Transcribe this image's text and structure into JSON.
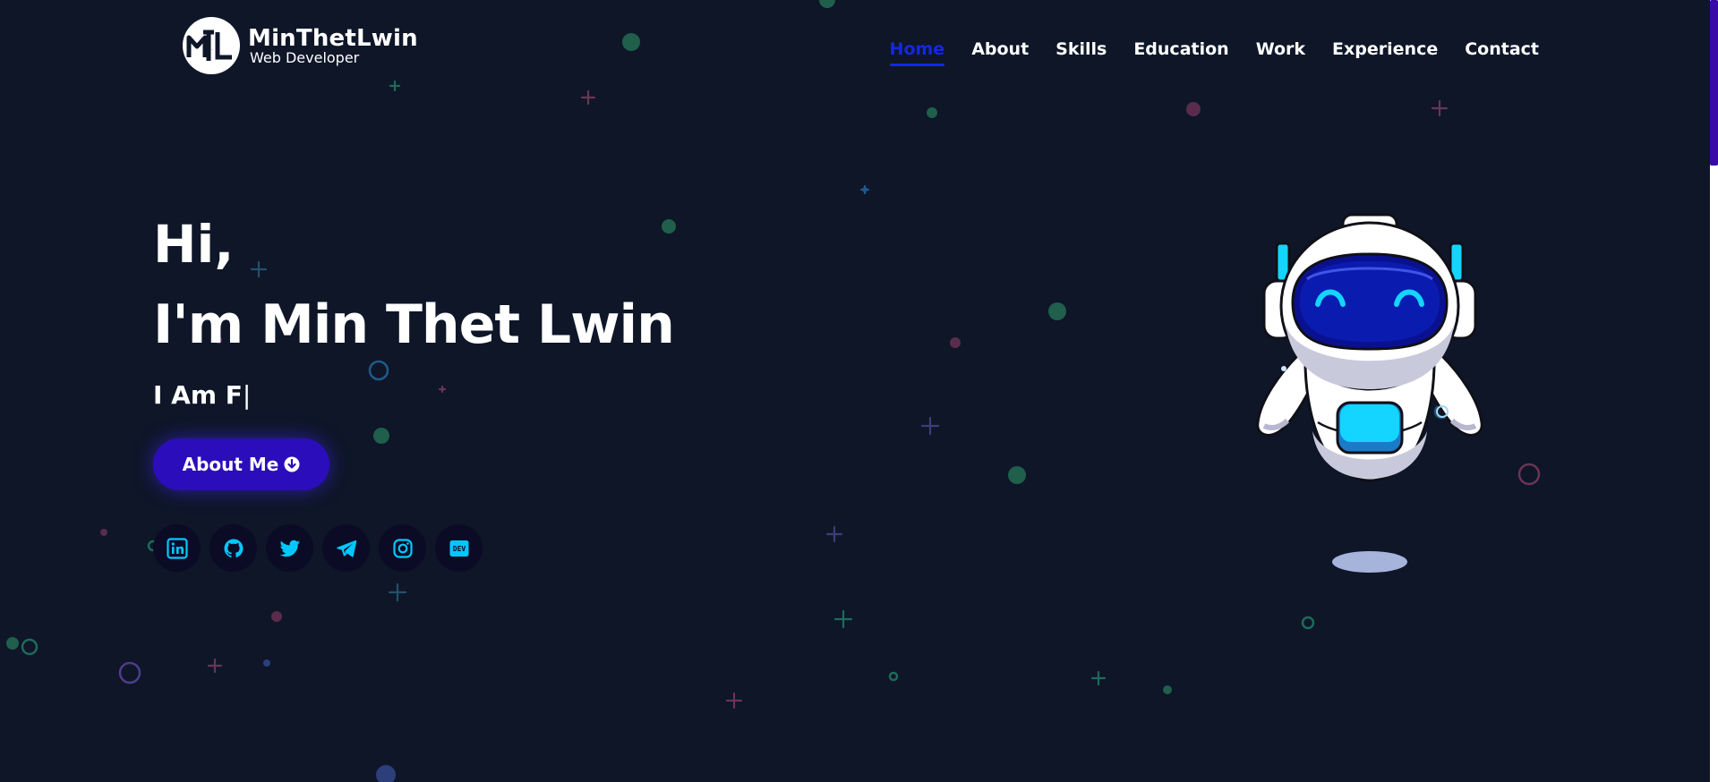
{
  "brand": {
    "monogram": "MTL",
    "name": "MinThetLwin",
    "subtitle": "Web Developer"
  },
  "nav": {
    "items": [
      {
        "label": "Home",
        "active": true
      },
      {
        "label": "About",
        "active": false
      },
      {
        "label": "Skills",
        "active": false
      },
      {
        "label": "Education",
        "active": false
      },
      {
        "label": "Work",
        "active": false
      },
      {
        "label": "Experience",
        "active": false
      },
      {
        "label": "Contact",
        "active": false
      }
    ]
  },
  "hero": {
    "greeting": "Hi,",
    "name": "I'm Min Thet Lwin",
    "typed_text": "I Am F",
    "caret": "|",
    "cta_label": "About Me",
    "cta_icon": "arrow-down-circle-icon"
  },
  "socials": [
    {
      "name": "linkedin",
      "icon": "linkedin-icon"
    },
    {
      "name": "github",
      "icon": "github-icon"
    },
    {
      "name": "twitter",
      "icon": "twitter-icon"
    },
    {
      "name": "telegram",
      "icon": "telegram-icon"
    },
    {
      "name": "instagram",
      "icon": "instagram-icon"
    },
    {
      "name": "dev",
      "icon": "dev-icon",
      "label": "DEV"
    }
  ],
  "colors": {
    "background": "#0e1628",
    "accent": "#1526e6",
    "button": "#2b0dbc",
    "social_icon": "#00c8ff",
    "robot_visor": "#0a1190",
    "robot_glow": "#13d5ff"
  }
}
